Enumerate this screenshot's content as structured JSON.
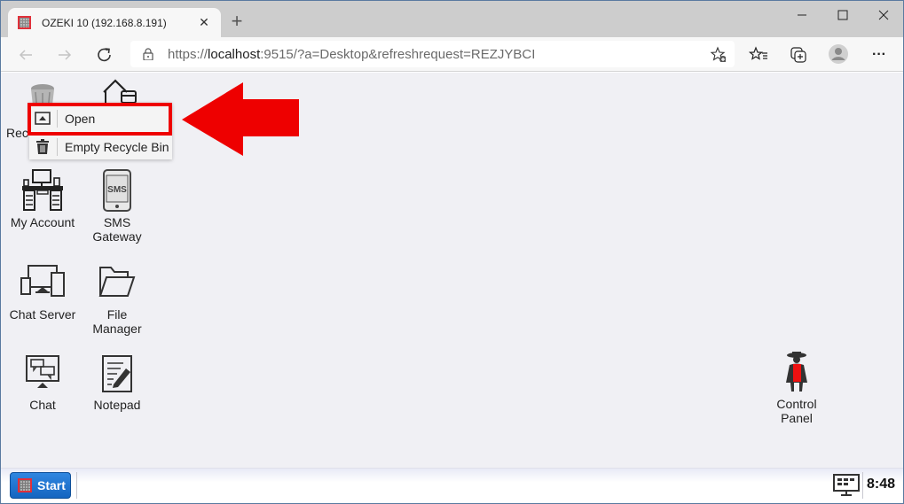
{
  "browser": {
    "tab": {
      "title": "OZEKI 10 (192.168.8.191)",
      "favicon": "ozeki-grid-icon",
      "close": "✕"
    },
    "new_tab": "+",
    "window_controls": {
      "minimize": "—",
      "maximize": "☐",
      "close": "✕"
    },
    "nav": {
      "back": "←",
      "forward": "→",
      "reload": "↻"
    },
    "address": {
      "scheme": "https://",
      "host": "localhost",
      "rest": ":9515/?a=Desktop&refreshrequest=REZJYBCI"
    },
    "toolbar_icons": [
      "add-favorite-icon",
      "favorites-icon",
      "collections-icon",
      "profile-icon",
      "more-icon"
    ],
    "more": "···"
  },
  "desktop": {
    "icons": [
      {
        "id": "recycle-bin",
        "label": "Rec"
      },
      {
        "id": "home",
        "label": ""
      },
      {
        "id": "my-account",
        "label": "My Account"
      },
      {
        "id": "sms-gateway",
        "label": "SMS Gateway",
        "line1": "SMS",
        "line2": "Gateway",
        "glyph": "SMS"
      },
      {
        "id": "chat-server",
        "label": "Chat Server"
      },
      {
        "id": "file-manager",
        "label": "File Manager",
        "line1": "File",
        "line2": "Manager"
      },
      {
        "id": "chat",
        "label": "Chat"
      },
      {
        "id": "notepad",
        "label": "Notepad"
      },
      {
        "id": "control-panel",
        "label": "Control Panel",
        "line1": "Control",
        "line2": "Panel"
      }
    ],
    "context_menu": {
      "items": [
        {
          "label": "Open",
          "icon": "open-window-icon",
          "highlighted": true
        },
        {
          "label": "Empty Recycle Bin",
          "icon": "trash-icon"
        }
      ]
    },
    "annotation": {
      "type": "arrow",
      "color": "#ee0000",
      "points_to": "Open"
    }
  },
  "taskbar": {
    "start_label": "Start",
    "clock": "8:48",
    "tray_icon": "desktop-monitor-icon"
  },
  "colors": {
    "accent": "#1565c0",
    "highlight": "#ee0000",
    "desktop_bg": "#f0f0f4"
  }
}
